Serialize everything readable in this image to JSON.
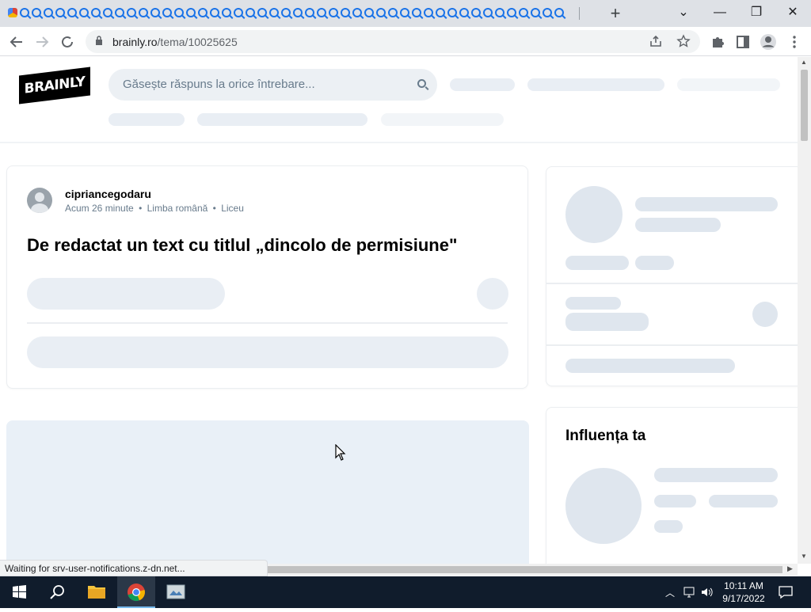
{
  "browser": {
    "tab_count_visible": 46,
    "new_tab_label": "+",
    "window_controls": {
      "tabsearch": "⌄",
      "minimize": "—",
      "restore": "❐",
      "close": "✕"
    },
    "url_domain": "brainly.ro",
    "url_path": "/tema/10025625",
    "status_text": "Waiting for srv-user-notifications.z-dn.net..."
  },
  "site": {
    "logo_text": "BRAINLY",
    "search_placeholder": "Găsește răspuns la orice întrebare..."
  },
  "question": {
    "username": "cipriancegodaru",
    "meta": [
      "Acum 26 minute",
      "Limba română",
      "Liceu"
    ],
    "title": "De redactat un text cu titlul „dincolo de permisiune\""
  },
  "sidebar": {
    "influence_title": "Influența ta"
  },
  "taskbar": {
    "time": "10:11 AM",
    "date": "9/17/2022"
  },
  "colors": {
    "skeleton": "#e9eef4",
    "skeleton_dark": "#dfe6ee",
    "taskbar": "#101c2c",
    "tabstrip": "#dee1e6"
  }
}
